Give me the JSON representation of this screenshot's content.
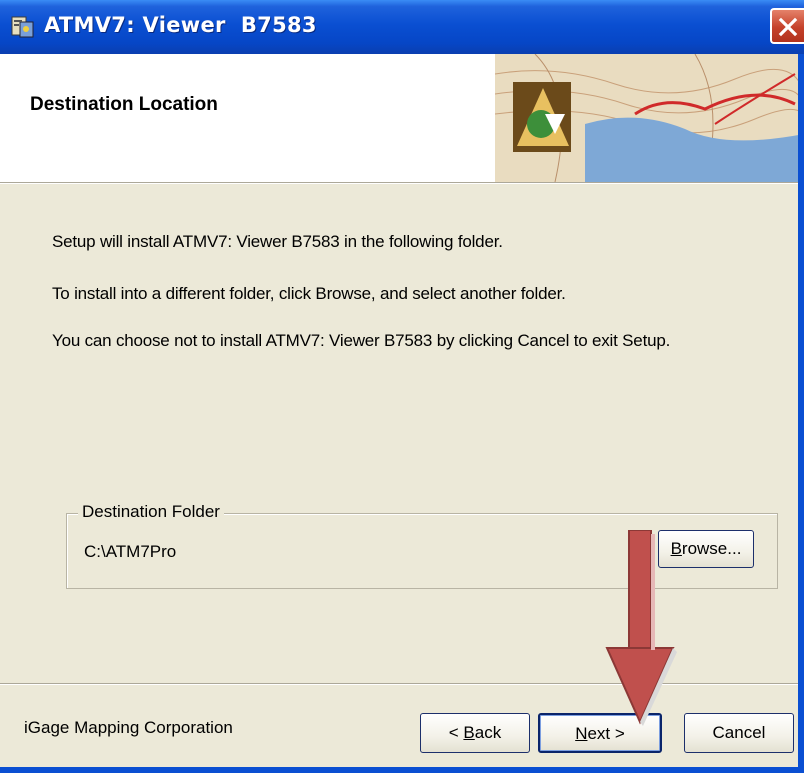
{
  "window": {
    "title": "ATMV7: Viewer  B7583",
    "close_icon": "close-icon"
  },
  "banner": {
    "title": "Destination Location",
    "image_icon": "topographic-map-logo"
  },
  "body": {
    "line1": "Setup will install ATMV7: Viewer  B7583 in the following folder.",
    "line2": "To install into a different folder, click Browse, and select another folder.",
    "line3": "You can choose not to install ATMV7: Viewer  B7583 by clicking Cancel to exit Setup."
  },
  "destination": {
    "legend": "Destination Folder",
    "path": "C:\\ATM7Pro",
    "browse_label_mnemonic": "B",
    "browse_label_rest": "rowse..."
  },
  "footer": {
    "company": "iGage Mapping Corporation",
    "back_prefix": "< ",
    "back_mnemonic": "B",
    "back_rest": "ack",
    "next_mnemonic": "N",
    "next_rest": "ext >",
    "cancel_label": "Cancel"
  },
  "annotation": {
    "arrow_icon": "red-down-arrow-icon",
    "arrow_color": "#c0504d"
  }
}
